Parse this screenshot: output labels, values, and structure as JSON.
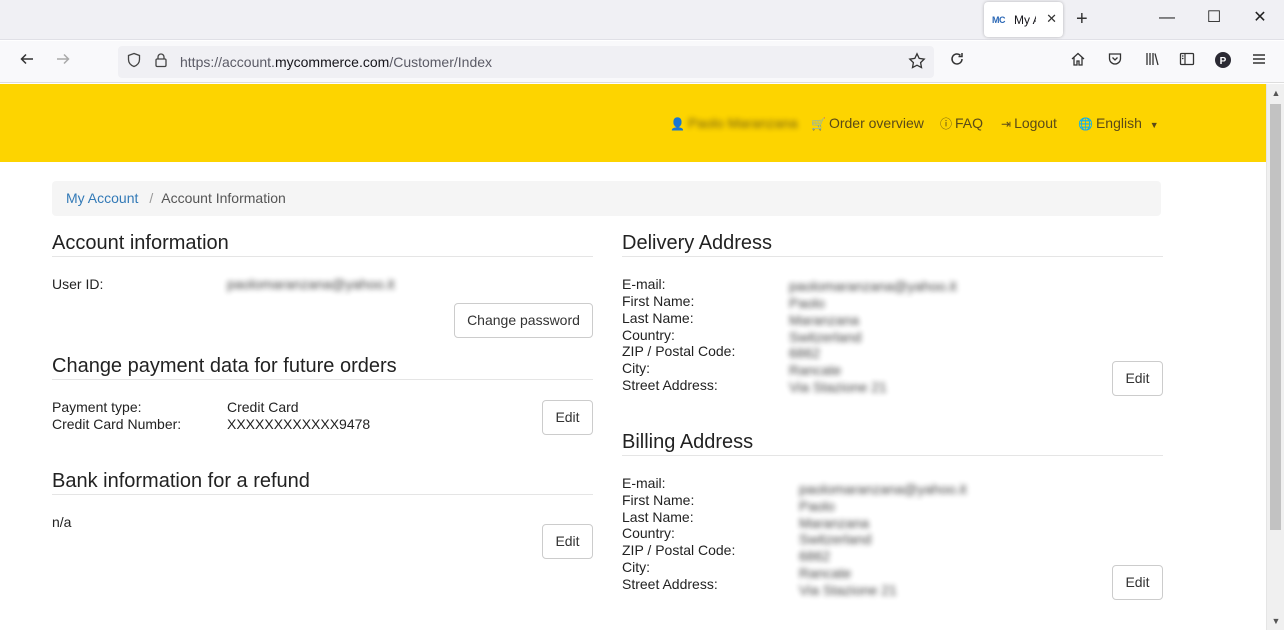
{
  "browser": {
    "tab_title": "My A",
    "favicon_text": "MC",
    "url_prefix": "https://account.",
    "url_domain": "mycommerce.com",
    "url_path": "/Customer/Index"
  },
  "header": {
    "user_name": "Paolo Maranzana",
    "order_overview": "Order overview",
    "faq": "FAQ",
    "logout": "Logout",
    "language": "English",
    "background_color": "#fdd400"
  },
  "breadcrumb": {
    "root": "My Account",
    "separator": "/",
    "current": "Account Information"
  },
  "account": {
    "title": "Account information",
    "user_id_label": "User ID:",
    "user_id_value": "paolomaranzana@yahoo.it",
    "change_password": "Change password"
  },
  "payment": {
    "title": "Change payment data for future orders",
    "type_label": "Payment type:",
    "type_value": "Credit Card",
    "card_label": "Credit Card Number:",
    "card_value": "XXXXXXXXXXXX9478",
    "edit": "Edit"
  },
  "bank": {
    "title": "Bank information for a refund",
    "value": "n/a",
    "edit": "Edit"
  },
  "delivery": {
    "title": "Delivery Address",
    "labels": [
      "E-mail:",
      "First Name:",
      "Last Name:",
      "Country:",
      "ZIP / Postal Code:",
      "City:",
      "Street Address:"
    ],
    "values": [
      "paolomaranzana@yahoo.it",
      "Paolo",
      "Maranzana",
      "Switzerland",
      "6862",
      "Rancate",
      "Via Stazione 21"
    ],
    "edit": "Edit"
  },
  "billing": {
    "title": "Billing Address",
    "labels": [
      "E-mail:",
      "First Name:",
      "Last Name:",
      "Country:",
      "ZIP / Postal Code:",
      "City:",
      "Street Address:"
    ],
    "values": [
      "paolomaranzana@yahoo.it",
      "Paolo",
      "Maranzana",
      "Switzerland",
      "6862",
      "Rancate",
      "Via Stazione 21"
    ],
    "edit": "Edit"
  }
}
